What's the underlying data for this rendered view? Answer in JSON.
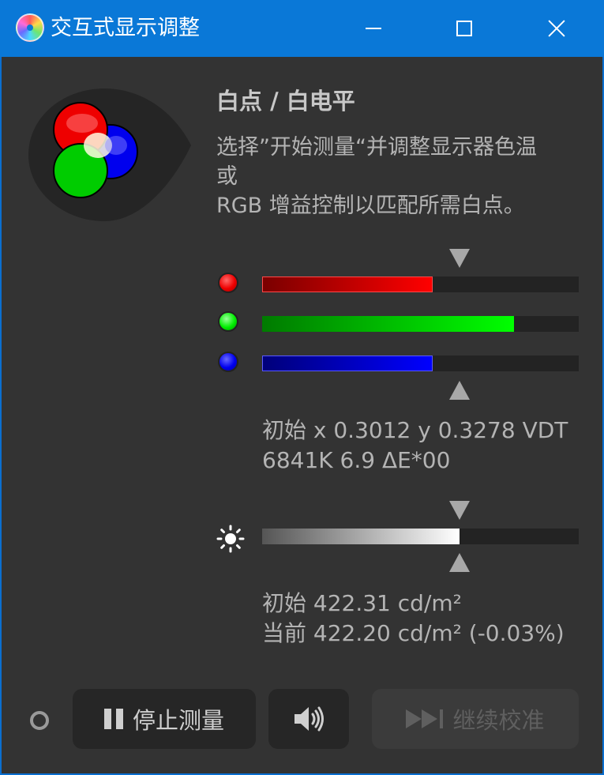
{
  "window": {
    "title": "交互式显示调整",
    "icon": "color-disc-icon"
  },
  "panel": {
    "heading": "白点 / 白电平",
    "description_lines": [
      "选择”开始测量“并调整显示器色温",
      "或",
      "RGB 增益控制以匹配所需白点。"
    ]
  },
  "rgb_bars": [
    {
      "channel": "red",
      "color": "#ff0000",
      "level": 0.538
    },
    {
      "channel": "green",
      "color": "#00ff00",
      "level": 0.795
    },
    {
      "channel": "blue",
      "color": "#0000ff",
      "level": 0.538
    }
  ],
  "white_point": {
    "line1": "初始 x 0.3012 y 0.3278 VDT",
    "line2": "6841K 6.9 ΔE*00"
  },
  "luminance": {
    "level": 0.623,
    "initial": "初始 422.31 cd/m²",
    "current": "当前 422.20 cd/m² (-0.03%)"
  },
  "buttons": {
    "stop_label": "停止测量",
    "continue_label": "继续校准"
  },
  "colors": {
    "titlebar": "#0a78d7",
    "background": "#333333",
    "button_bg": "#262626"
  }
}
